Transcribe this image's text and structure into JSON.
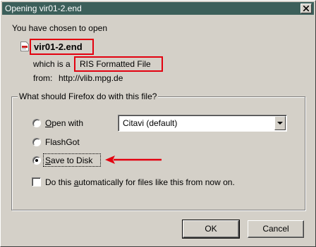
{
  "window": {
    "title": "Opening vir01-2.end"
  },
  "intro": {
    "text": "You have chosen to open"
  },
  "file": {
    "name": "vir01-2.end",
    "icon": "document-icon"
  },
  "type_row": {
    "label": "which is a",
    "value": "RIS Formatted File"
  },
  "from_row": {
    "label": "from:",
    "value": "http://vlib.mpg.de"
  },
  "group": {
    "legend": "What should Firefox do with this file?"
  },
  "options": {
    "open_with": {
      "label_ul": "O",
      "label_rest": "pen with",
      "app": "Citavi (default)",
      "selected": false
    },
    "flashgot": {
      "label": "FlashGot",
      "selected": false
    },
    "save": {
      "label_ul": "S",
      "label_rest": "ave to Disk",
      "selected": true
    },
    "auto": {
      "label_pre": "Do this ",
      "label_ul": "a",
      "label_rest": "utomatically for files like this from now on.",
      "checked": false
    }
  },
  "buttons": {
    "ok": "OK",
    "cancel": "Cancel"
  },
  "colors": {
    "highlight_border": "#e3000f",
    "arrow": "#e3000f",
    "titlebar": "#3c5f5a"
  }
}
